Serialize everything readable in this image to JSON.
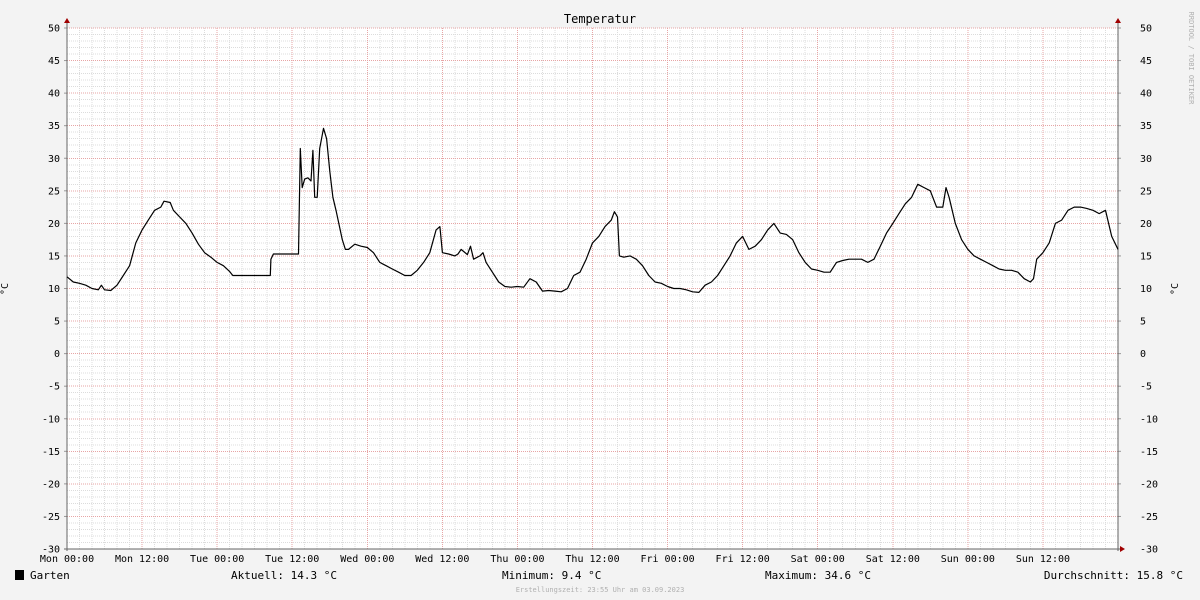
{
  "chart_data": {
    "type": "line",
    "title": "Temperatur",
    "ylabel": "°C",
    "ylim": [
      -30,
      50
    ],
    "yticks": [
      50,
      45,
      40,
      35,
      30,
      25,
      20,
      15,
      10,
      5,
      0,
      -5,
      -10,
      -15,
      -20,
      -25,
      -30
    ],
    "xlim_hours": [
      0,
      168
    ],
    "x_tick_labels": [
      {
        "label": "Mon 00:00",
        "hour": 0
      },
      {
        "label": "Mon 12:00",
        "hour": 12
      },
      {
        "label": "Tue 00:00",
        "hour": 24
      },
      {
        "label": "Tue 12:00",
        "hour": 36
      },
      {
        "label": "Wed 00:00",
        "hour": 48
      },
      {
        "label": "Wed 12:00",
        "hour": 60
      },
      {
        "label": "Thu 00:00",
        "hour": 72
      },
      {
        "label": "Thu 12:00",
        "hour": 84
      },
      {
        "label": "Fri 00:00",
        "hour": 96
      },
      {
        "label": "Fri 12:00",
        "hour": 108
      },
      {
        "label": "Sat 00:00",
        "hour": 120
      },
      {
        "label": "Sat 12:00",
        "hour": 132
      },
      {
        "label": "Sun 00:00",
        "hour": 144
      },
      {
        "label": "Sun 12:00",
        "hour": 156
      }
    ],
    "series": [
      {
        "name": "Garten",
        "color": "#000000",
        "points": [
          [
            0,
            11.8
          ],
          [
            1,
            11.0
          ],
          [
            2,
            10.8
          ],
          [
            3,
            10.5
          ],
          [
            4,
            10.0
          ],
          [
            5,
            9.8
          ],
          [
            5.5,
            10.5
          ],
          [
            6,
            9.8
          ],
          [
            7,
            9.7
          ],
          [
            8,
            10.5
          ],
          [
            9,
            12.0
          ],
          [
            10,
            13.5
          ],
          [
            11,
            17.0
          ],
          [
            12,
            19.0
          ],
          [
            13,
            20.5
          ],
          [
            14,
            22.0
          ],
          [
            15,
            22.5
          ],
          [
            15.5,
            23.4
          ],
          [
            16.5,
            23.2
          ],
          [
            17,
            22.0
          ],
          [
            18,
            21.0
          ],
          [
            19,
            20.0
          ],
          [
            20,
            18.5
          ],
          [
            21,
            16.8
          ],
          [
            22,
            15.5
          ],
          [
            23,
            14.8
          ],
          [
            24,
            14.0
          ],
          [
            25,
            13.5
          ],
          [
            26,
            12.6
          ],
          [
            26.5,
            12.0
          ],
          [
            28,
            12.0
          ],
          [
            30,
            12.0
          ],
          [
            32,
            12.0
          ],
          [
            32.5,
            12.0
          ],
          [
            32.6,
            14.5
          ],
          [
            33,
            15.3
          ],
          [
            34,
            15.3
          ],
          [
            35,
            15.3
          ],
          [
            36,
            15.3
          ],
          [
            37,
            15.3
          ],
          [
            37.3,
            31.5
          ],
          [
            37.6,
            25.5
          ],
          [
            38,
            26.8
          ],
          [
            38.5,
            27.0
          ],
          [
            39,
            26.5
          ],
          [
            39.3,
            31.2
          ],
          [
            39.6,
            24.0
          ],
          [
            40,
            24.0
          ],
          [
            40.4,
            31.5
          ],
          [
            41,
            34.6
          ],
          [
            41.5,
            33.0
          ],
          [
            42,
            28.0
          ],
          [
            42.5,
            24.0
          ],
          [
            43,
            22.0
          ],
          [
            44,
            17.5
          ],
          [
            44.5,
            16.0
          ],
          [
            45,
            16.0
          ],
          [
            46,
            16.8
          ],
          [
            47,
            16.5
          ],
          [
            48,
            16.3
          ],
          [
            49,
            15.5
          ],
          [
            50,
            14.0
          ],
          [
            51,
            13.5
          ],
          [
            52,
            13.0
          ],
          [
            53,
            12.5
          ],
          [
            54,
            12.0
          ],
          [
            55,
            12.0
          ],
          [
            56,
            12.8
          ],
          [
            57,
            14.0
          ],
          [
            58,
            15.5
          ],
          [
            59,
            19.0
          ],
          [
            59.6,
            19.5
          ],
          [
            60,
            15.5
          ],
          [
            61,
            15.3
          ],
          [
            62,
            15.0
          ],
          [
            62.5,
            15.3
          ],
          [
            63,
            16.0
          ],
          [
            64,
            15.2
          ],
          [
            64.5,
            16.5
          ],
          [
            65,
            14.5
          ],
          [
            66,
            15.0
          ],
          [
            66.5,
            15.5
          ],
          [
            67,
            14.0
          ],
          [
            68,
            12.5
          ],
          [
            69,
            11.0
          ],
          [
            70,
            10.3
          ],
          [
            71,
            10.2
          ],
          [
            72,
            10.3
          ],
          [
            73,
            10.2
          ],
          [
            74,
            11.5
          ],
          [
            75,
            11.0
          ],
          [
            76,
            9.6
          ],
          [
            77,
            9.7
          ],
          [
            78,
            9.6
          ],
          [
            79,
            9.5
          ],
          [
            80,
            10.0
          ],
          [
            81,
            12.0
          ],
          [
            82,
            12.5
          ],
          [
            83,
            14.5
          ],
          [
            84,
            17.0
          ],
          [
            85,
            18.0
          ],
          [
            86,
            19.5
          ],
          [
            87,
            20.5
          ],
          [
            87.5,
            21.8
          ],
          [
            88,
            21.0
          ],
          [
            88.3,
            15.0
          ],
          [
            89,
            14.8
          ],
          [
            90,
            15.0
          ],
          [
            91,
            14.5
          ],
          [
            92,
            13.5
          ],
          [
            93,
            12.0
          ],
          [
            94,
            11.0
          ],
          [
            95,
            10.8
          ],
          [
            96,
            10.3
          ],
          [
            97,
            10.0
          ],
          [
            98,
            10.0
          ],
          [
            99,
            9.8
          ],
          [
            100,
            9.5
          ],
          [
            101,
            9.4
          ],
          [
            102,
            10.5
          ],
          [
            103,
            11.0
          ],
          [
            104,
            12.0
          ],
          [
            105,
            13.5
          ],
          [
            106,
            15.0
          ],
          [
            107,
            17.0
          ],
          [
            108,
            18.0
          ],
          [
            109,
            16.0
          ],
          [
            110,
            16.5
          ],
          [
            111,
            17.5
          ],
          [
            112,
            19.0
          ],
          [
            113,
            20.0
          ],
          [
            114,
            18.5
          ],
          [
            115,
            18.3
          ],
          [
            116,
            17.5
          ],
          [
            117,
            15.5
          ],
          [
            118,
            14.0
          ],
          [
            119,
            13.0
          ],
          [
            120,
            12.8
          ],
          [
            121,
            12.5
          ],
          [
            122,
            12.5
          ],
          [
            123,
            14.0
          ],
          [
            124,
            14.3
          ],
          [
            125,
            14.5
          ],
          [
            126,
            14.5
          ],
          [
            127,
            14.5
          ],
          [
            128,
            14.0
          ],
          [
            129,
            14.5
          ],
          [
            130,
            16.5
          ],
          [
            131,
            18.5
          ],
          [
            132,
            20.0
          ],
          [
            133,
            21.5
          ],
          [
            134,
            23.0
          ],
          [
            135,
            24.0
          ],
          [
            136,
            26.0
          ],
          [
            137,
            25.5
          ],
          [
            138,
            25.0
          ],
          [
            139,
            22.5
          ],
          [
            140,
            22.5
          ],
          [
            140.5,
            25.5
          ],
          [
            141,
            24.0
          ],
          [
            142,
            20.0
          ],
          [
            143,
            17.5
          ],
          [
            144,
            16.0
          ],
          [
            145,
            15.0
          ],
          [
            146,
            14.5
          ],
          [
            147,
            14.0
          ],
          [
            148,
            13.5
          ],
          [
            149,
            13.0
          ],
          [
            150,
            12.8
          ],
          [
            151,
            12.8
          ],
          [
            152,
            12.5
          ],
          [
            153,
            11.5
          ],
          [
            154,
            11.0
          ],
          [
            154.5,
            11.5
          ],
          [
            155,
            14.5
          ],
          [
            156,
            15.5
          ],
          [
            157,
            17.0
          ],
          [
            158,
            20.0
          ],
          [
            159,
            20.5
          ],
          [
            160,
            22.0
          ],
          [
            161,
            22.5
          ],
          [
            162,
            22.5
          ],
          [
            163,
            22.3
          ],
          [
            164,
            22.0
          ],
          [
            165,
            21.5
          ],
          [
            166,
            22.0
          ],
          [
            167,
            18.0
          ],
          [
            168,
            16.0
          ],
          [
            169,
            14.5
          ],
          [
            170,
            14.3
          ]
        ]
      }
    ]
  },
  "vertical_label": "RRDTOOL / TOBI OETIKER",
  "footer": {
    "legend_label": "Garten",
    "current": "Aktuell: 14.3 °C",
    "minimum": "Minimum: 9.4 °C",
    "maximum": "Maximum: 34.6 °C",
    "average": "Durchschnitt: 15.8 °C",
    "timestamp": "Erstellungszeit: 23:55 Uhr am 03.09.2023"
  },
  "colors": {
    "background": "#f3f3f3",
    "plot_background": "#ffffff",
    "minor_grid": "#dcdcdc",
    "major_grid": "#e7a5a5",
    "axis_arrow": "#a00000",
    "line": "#000000"
  }
}
